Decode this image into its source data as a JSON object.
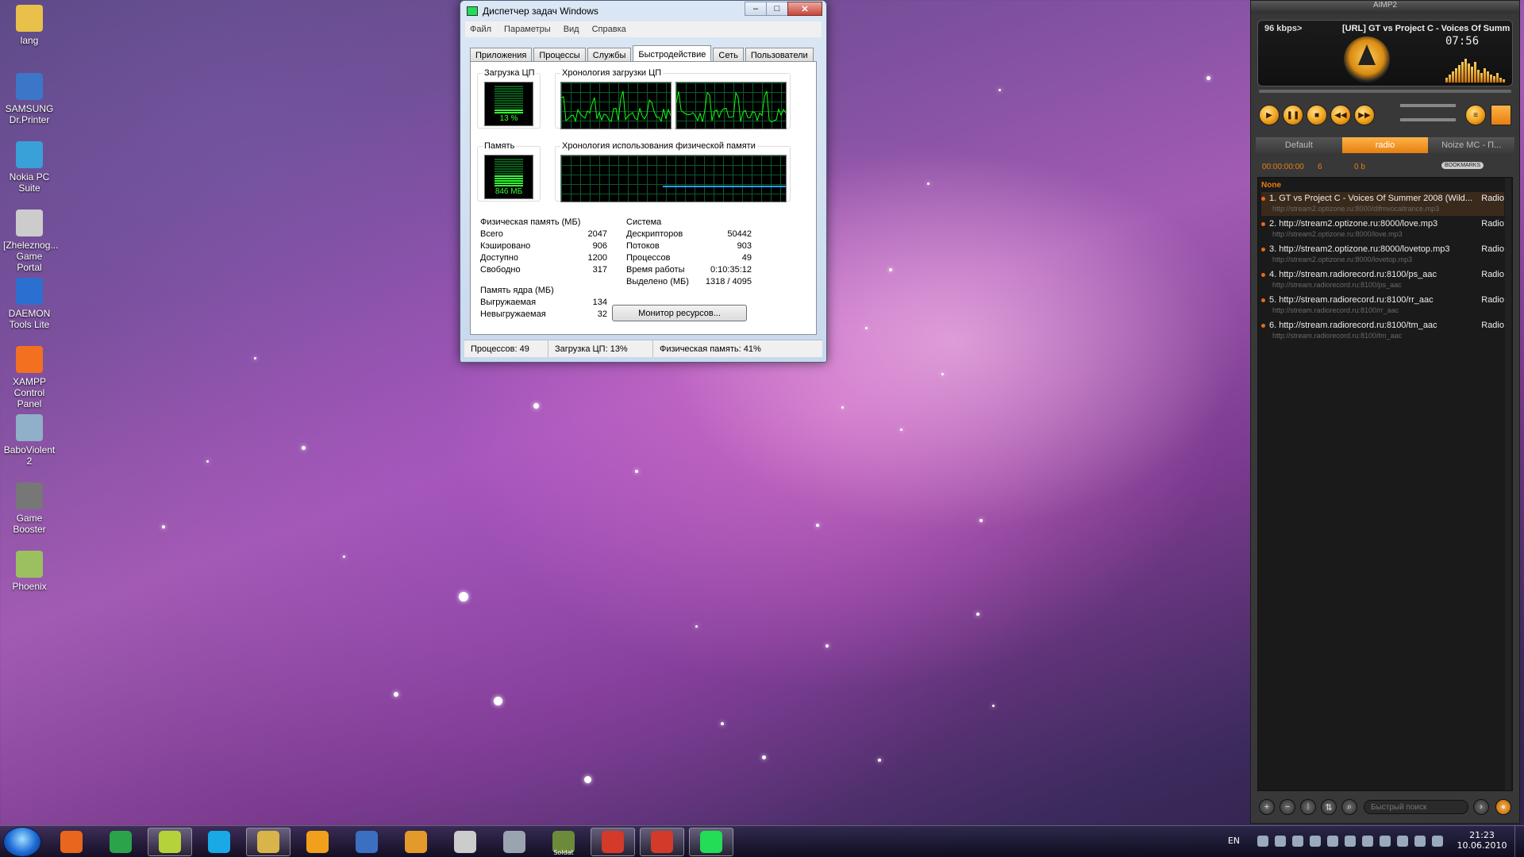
{
  "desktop_icons": [
    {
      "label": "lang",
      "icon": "folder-icon",
      "color": "#e8c04a"
    },
    {
      "label": "SAMSUNG Dr.Printer",
      "icon": "printer-icon",
      "color": "#3c76c8"
    },
    {
      "label": "Nokia PC Suite",
      "icon": "nokia-icon",
      "color": "#3aa0d8"
    },
    {
      "label": "[Zheleznog... Game Portal",
      "icon": "game-portal-icon",
      "color": "#cccccc"
    },
    {
      "label": "DAEMON Tools Lite",
      "icon": "daemon-tools-icon",
      "color": "#2b6fd0"
    },
    {
      "label": "XAMPP Control Panel",
      "icon": "xampp-icon",
      "color": "#f37021"
    },
    {
      "label": "BaboViolent 2",
      "icon": "babo-icon",
      "color": "#8fb0c8"
    },
    {
      "label": "Game Booster",
      "icon": "game-booster-icon",
      "color": "#777777"
    },
    {
      "label": "Phoenix",
      "icon": "phoenix-icon",
      "color": "#9cc060"
    }
  ],
  "taskmgr": {
    "title": "Диспетчер задач Windows",
    "menu": [
      "Файл",
      "Параметры",
      "Вид",
      "Справка"
    ],
    "tabs": [
      "Приложения",
      "Процессы",
      "Службы",
      "Быстродействие",
      "Сеть",
      "Пользователи"
    ],
    "active_tab": "Быстродействие",
    "cpu_label": "Загрузка ЦП",
    "cpu_value": "13 %",
    "cpu_level": 0.13,
    "cpu_history_label": "Хронология загрузки ЦП",
    "mem_label": "Память",
    "mem_value": "846 МБ",
    "mem_level": 0.41,
    "mem_history_label": "Хронология использования физической памяти",
    "phys": {
      "title": "Физическая память (МБ)",
      "rows": [
        [
          "Всего",
          "2047"
        ],
        [
          "Кэшировано",
          "906"
        ],
        [
          "Доступно",
          "1200"
        ],
        [
          "Свободно",
          "317"
        ]
      ]
    },
    "kernel": {
      "title": "Память ядра (МБ)",
      "rows": [
        [
          "Выгружаемая",
          "134"
        ],
        [
          "Невыгружаемая",
          "32"
        ]
      ]
    },
    "system": {
      "title": "Система",
      "rows": [
        [
          "Дескрипторов",
          "50442"
        ],
        [
          "Потоков",
          "903"
        ],
        [
          "Процессов",
          "49"
        ],
        [
          "Время работы",
          "0:10:35:12"
        ],
        [
          "Выделено (МБ)",
          "1318 / 4095"
        ]
      ]
    },
    "resource_button": "Монитор ресурсов...",
    "status": [
      "Процессов: 49",
      "Загрузка ЦП: 13%",
      "Физическая память: 41%"
    ]
  },
  "aimp": {
    "title": "AIMP2",
    "bitrate": "96 kbps>",
    "track_title": "[URL] GT vs Project C - Voices Of Summ",
    "time": "07:56",
    "tabs": [
      "Default",
      "radio",
      "Noize MC - П..."
    ],
    "active_tab": "radio",
    "counter": "00:00:00:00",
    "count": "6",
    "size": "0 b",
    "bookmarks": "BOOKMARKS",
    "group": "None",
    "playlist": [
      {
        "title": "1. GT vs Project C - Voices Of Summer 2008 (Wild...",
        "tag": "Radio",
        "url": "http://stream2.optizone.ru:8000/difmvocaltrance.mp3"
      },
      {
        "title": "2. http://stream2.optizone.ru:8000/love.mp3",
        "tag": "Radio",
        "url": "http://stream2.optizone.ru:8000/love.mp3"
      },
      {
        "title": "3. http://stream2.optizone.ru:8000/lovetop.mp3",
        "tag": "Radio",
        "url": "http://stream2.optizone.ru:8000/lovetop.mp3"
      },
      {
        "title": "4. http://stream.radiorecord.ru:8100/ps_aac",
        "tag": "Radio",
        "url": "http://stream.radiorecord.ru:8100/ps_aac"
      },
      {
        "title": "5. http://stream.radiorecord.ru:8100/rr_aac",
        "tag": "Radio",
        "url": "http://stream.radiorecord.ru:8100/rr_aac"
      },
      {
        "title": "6. http://stream.radiorecord.ru:8100/tm_aac",
        "tag": "Radio",
        "url": "http://stream.radiorecord.ru:8100/tm_aac"
      }
    ],
    "search_placeholder": "Быстрый поиск"
  },
  "taskbar": {
    "apps": [
      {
        "name": "firefox-icon",
        "color": "#e8671c"
      },
      {
        "name": "utorrent-icon",
        "color": "#2aa34a"
      },
      {
        "name": "n-app-icon",
        "color": "#b6d23a"
      },
      {
        "name": "skype-icon",
        "color": "#19a9e5"
      },
      {
        "name": "winamp-like-icon",
        "color": "#d9b44a"
      },
      {
        "name": "aimp-icon",
        "color": "#f0a01a"
      },
      {
        "name": "outlook-icon",
        "color": "#3b6fc2"
      },
      {
        "name": "butterfly-icon",
        "color": "#e39a2a"
      },
      {
        "name": "counter-strike-icon",
        "color": "#cccccc"
      },
      {
        "name": "starcraft-icon",
        "color": "#9aa4b0"
      },
      {
        "name": "soldat-icon",
        "color": "#6b8a3a"
      },
      {
        "name": "half-life-icon",
        "color": "#d33a2a"
      },
      {
        "name": "half-life-2-icon",
        "color": "#d33a2a"
      },
      {
        "name": "taskmgr-icon",
        "color": "#2d5"
      }
    ],
    "soldat_label": "Soldat",
    "lang": "EN",
    "time": "21:23",
    "date": "10.06.2010"
  }
}
